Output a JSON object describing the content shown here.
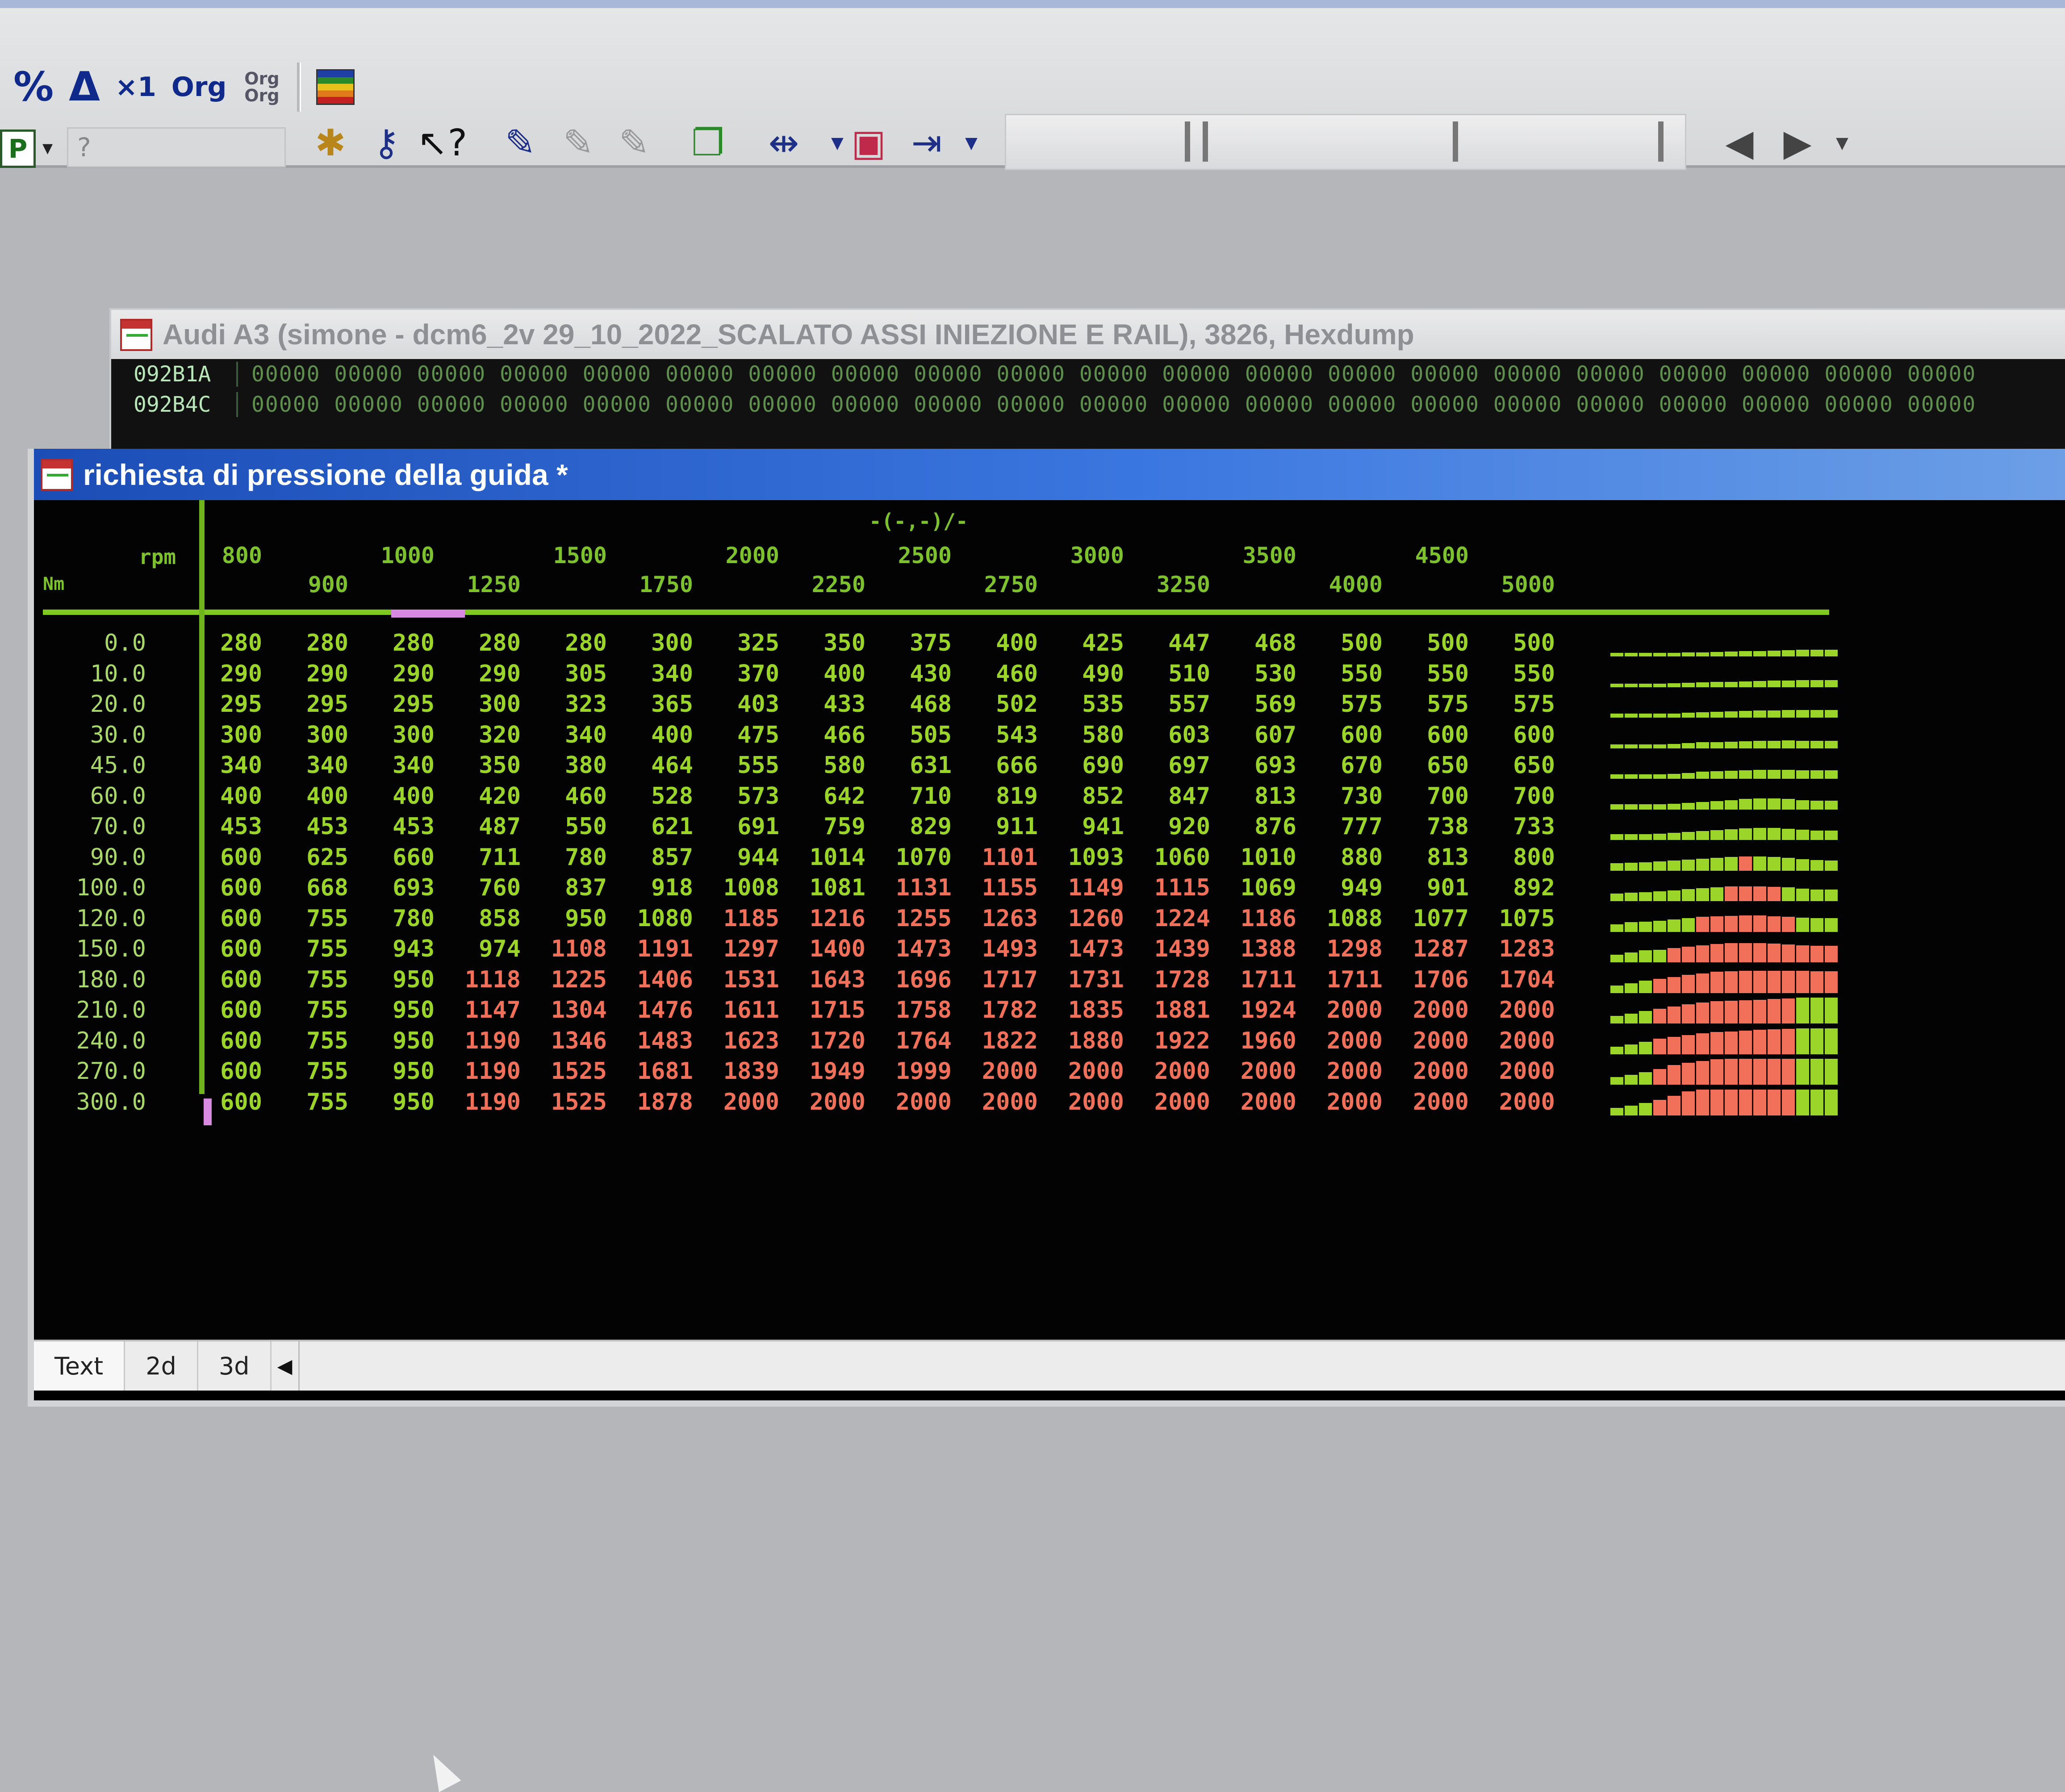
{
  "toolbar": {
    "row1": [
      "%",
      "Δ",
      "×1",
      "Org",
      "Org Org"
    ],
    "p_field": "P",
    "help_placeholder": "?"
  },
  "hexdump": {
    "title": "Audi A3 (simone - dcm6_2v 29_10_2022_SCALATO ASSI INIEZIONE E RAIL), 3826, Hexdump",
    "rows": [
      {
        "addr": "092B1A",
        "data": "00000 00000 00000 00000 00000 00000 00000 00000 00000 00000 00000 00000 00000 00000 00000 00000 00000 00000 00000 00000 00000"
      },
      {
        "addr": "092B4C",
        "data": "00000 00000 00000 00000 00000 00000 00000 00000 00000 00000 00000 00000 00000 00000 00000 00000 00000 00000 00000 00000 00000"
      }
    ]
  },
  "map": {
    "title": "richiesta di pressione della guida *",
    "header_symbol": "-(-,-)/-",
    "x_axis_label": "rpm",
    "y_axis_label": "Nm",
    "rpm": [
      "800",
      "900",
      "1000",
      "1250",
      "1500",
      "1750",
      "2000",
      "2250",
      "2500",
      "2750",
      "3000",
      "3250",
      "3500",
      "4000",
      "4500",
      "5000"
    ],
    "nm": [
      "0.0",
      "10.0",
      "20.0",
      "30.0",
      "45.0",
      "60.0",
      "70.0",
      "90.0",
      "100.0",
      "120.0",
      "150.0",
      "180.0",
      "210.0",
      "240.0",
      "270.0",
      "300.0"
    ],
    "values": [
      [
        280,
        280,
        280,
        280,
        280,
        300,
        325,
        350,
        375,
        400,
        425,
        447,
        468,
        500,
        500,
        500
      ],
      [
        290,
        290,
        290,
        290,
        305,
        340,
        370,
        400,
        430,
        460,
        490,
        510,
        530,
        550,
        550,
        550
      ],
      [
        295,
        295,
        295,
        300,
        323,
        365,
        403,
        433,
        468,
        502,
        535,
        557,
        569,
        575,
        575,
        575
      ],
      [
        300,
        300,
        300,
        320,
        340,
        400,
        475,
        466,
        505,
        543,
        580,
        603,
        607,
        600,
        600,
        600
      ],
      [
        340,
        340,
        340,
        350,
        380,
        464,
        555,
        580,
        631,
        666,
        690,
        697,
        693,
        670,
        650,
        650
      ],
      [
        400,
        400,
        400,
        420,
        460,
        528,
        573,
        642,
        710,
        819,
        852,
        847,
        813,
        730,
        700,
        700
      ],
      [
        453,
        453,
        453,
        487,
        550,
        621,
        691,
        759,
        829,
        911,
        941,
        920,
        876,
        777,
        738,
        733
      ],
      [
        600,
        625,
        660,
        711,
        780,
        857,
        944,
        1014,
        1070,
        1101,
        1093,
        1060,
        1010,
        880,
        813,
        800
      ],
      [
        600,
        668,
        693,
        760,
        837,
        918,
        1008,
        1081,
        1131,
        1155,
        1149,
        1115,
        1069,
        949,
        901,
        892
      ],
      [
        600,
        755,
        780,
        858,
        950,
        1080,
        1185,
        1216,
        1255,
        1263,
        1260,
        1224,
        1186,
        1088,
        1077,
        1075
      ],
      [
        600,
        755,
        943,
        974,
        1108,
        1191,
        1297,
        1400,
        1473,
        1493,
        1473,
        1439,
        1388,
        1298,
        1287,
        1283
      ],
      [
        600,
        755,
        950,
        1118,
        1225,
        1406,
        1531,
        1643,
        1696,
        1717,
        1731,
        1728,
        1711,
        1711,
        1706,
        1704
      ],
      [
        600,
        755,
        950,
        1147,
        1304,
        1476,
        1611,
        1715,
        1758,
        1782,
        1835,
        1881,
        1924,
        2000,
        2000,
        2000
      ],
      [
        600,
        755,
        950,
        1190,
        1346,
        1483,
        1623,
        1720,
        1764,
        1822,
        1880,
        1922,
        1960,
        2000,
        2000,
        2000
      ],
      [
        600,
        755,
        950,
        1190,
        1525,
        1681,
        1839,
        1949,
        1999,
        2000,
        2000,
        2000,
        2000,
        2000,
        2000,
        2000
      ],
      [
        600,
        755,
        950,
        1190,
        1525,
        1878,
        2000,
        2000,
        2000,
        2000,
        2000,
        2000,
        2000,
        2000,
        2000,
        2000
      ]
    ],
    "red_threshold": 1100,
    "colors": {
      "low": "#9bd52a",
      "high": "#f0705a",
      "cursor": "#d88ae0",
      "rule": "#7ec81f"
    }
  },
  "tabs": [
    "Text",
    "2d",
    "3d"
  ],
  "active_tab": "Text"
}
